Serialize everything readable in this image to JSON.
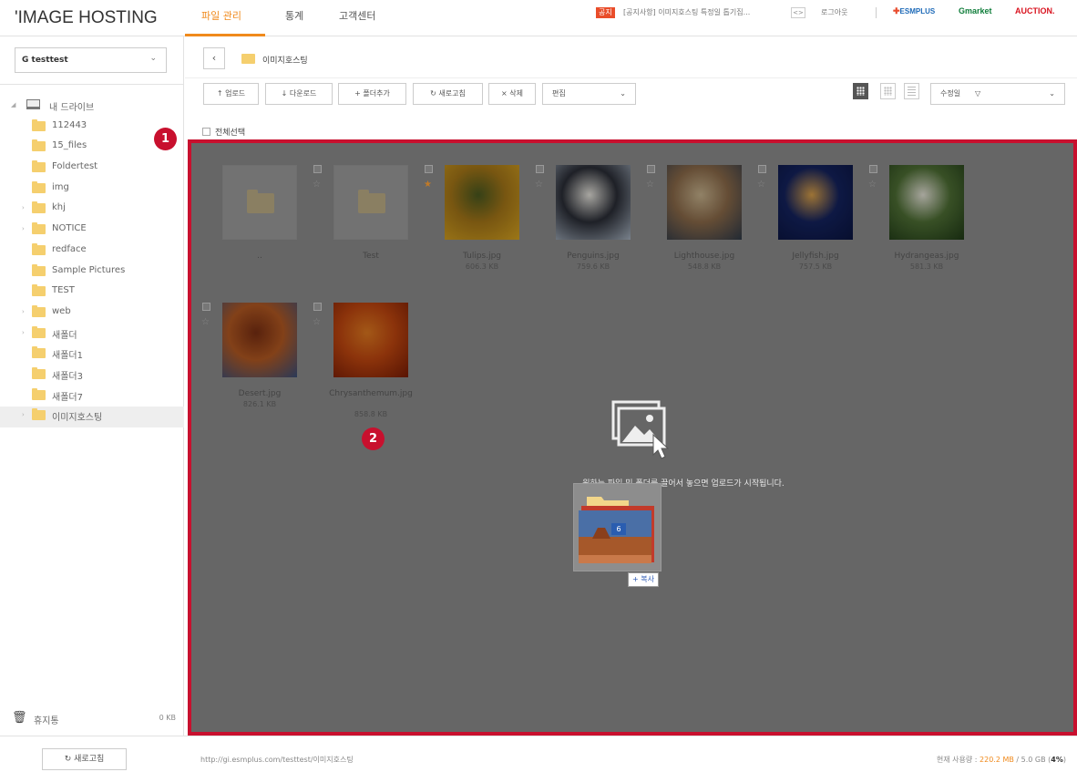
{
  "header": {
    "brand": "'IMAGE HOSTING",
    "tabs": [
      {
        "label": "파일 관리",
        "active": true
      },
      {
        "label": "통계",
        "active": false
      },
      {
        "label": "고객센터",
        "active": false
      }
    ],
    "notice_badge": "공지",
    "notice_text": "[공지사항] 이미지호스팅 특정일 톱기집...",
    "notice_more": "<>",
    "logout": "로그아웃",
    "partners": [
      "ESMPLUS",
      "Gmarket",
      "AUCTION."
    ],
    "accent_color": "#f08a1c"
  },
  "sidebar": {
    "account": "G testtest",
    "drive_label": "내 드라이브",
    "folders": [
      {
        "label": "112443",
        "expandable": false,
        "selected": false
      },
      {
        "label": "15_files",
        "expandable": false,
        "selected": false
      },
      {
        "label": "Foldertest",
        "expandable": false,
        "selected": false
      },
      {
        "label": "img",
        "expandable": false,
        "selected": false
      },
      {
        "label": "khj",
        "expandable": true,
        "selected": false
      },
      {
        "label": "NOTICE",
        "expandable": true,
        "selected": false
      },
      {
        "label": "redface",
        "expandable": false,
        "selected": false
      },
      {
        "label": "Sample Pictures",
        "expandable": false,
        "selected": false
      },
      {
        "label": "TEST",
        "expandable": false,
        "selected": false
      },
      {
        "label": "web",
        "expandable": true,
        "selected": false
      },
      {
        "label": "새폴더",
        "expandable": true,
        "selected": false
      },
      {
        "label": "새폴더1",
        "expandable": false,
        "selected": false
      },
      {
        "label": "새폴더3",
        "expandable": false,
        "selected": false
      },
      {
        "label": "새폴더7",
        "expandable": false,
        "selected": false
      },
      {
        "label": "이미지호스팅",
        "expandable": true,
        "selected": true
      }
    ],
    "trash_label": "휴지통",
    "trash_size": "0 KB",
    "refresh_label": "새로고침"
  },
  "main": {
    "path_label": "이미지호스팅",
    "toolbar": {
      "upload": "업로드",
      "download": "다운로드",
      "add_folder": "폴더추가",
      "refresh": "새로고침",
      "delete": "삭제",
      "edit_select": "편집",
      "sort_select": "수정일"
    },
    "select_all": "전체선택",
    "items": [
      {
        "type": "parent",
        "name": "..",
        "size": "",
        "starred": false,
        "checkbox": false
      },
      {
        "type": "folder",
        "name": "Test",
        "size": "",
        "starred": false,
        "checkbox": true
      },
      {
        "type": "image",
        "name": "Tulips.jpg",
        "size": "606.3 KB",
        "starred": true,
        "checkbox": true,
        "palette": [
          "#d9a520",
          "#a77818",
          "#4b5a1f"
        ]
      },
      {
        "type": "image",
        "name": "Penguins.jpg",
        "size": "759.6 KB",
        "starred": false,
        "checkbox": true,
        "palette": [
          "#a8b4c2",
          "#2a2d36",
          "#e8e6df"
        ]
      },
      {
        "type": "image",
        "name": "Lighthouse.jpg",
        "size": "548.8 KB",
        "starred": false,
        "checkbox": true,
        "palette": [
          "#2f3a48",
          "#8c6b4a",
          "#c9b48e"
        ]
      },
      {
        "type": "image",
        "name": "Jellyfish.jpg",
        "size": "757.5 KB",
        "starred": false,
        "checkbox": true,
        "palette": [
          "#0a1440",
          "#13225e",
          "#d9a04a"
        ]
      },
      {
        "type": "image",
        "name": "Hydrangeas.jpg",
        "size": "581.3 KB",
        "starred": false,
        "checkbox": true,
        "palette": [
          "#1f3a16",
          "#4e6f34",
          "#e6e4d8"
        ]
      },
      {
        "type": "image",
        "name": "Desert.jpg",
        "size": "826.1 KB",
        "starred": false,
        "checkbox": true,
        "palette": [
          "#3a4f7a",
          "#b55a22",
          "#7b2f12"
        ]
      },
      {
        "type": "image",
        "name": "Chrysanthemum.jpg",
        "size": "858.8 KB",
        "starred": false,
        "checkbox": true,
        "palette": [
          "#7a1c05",
          "#c2470f",
          "#e27a20"
        ]
      }
    ],
    "drop_hint": "원하는 파일 및 폴더를 끌어서 놓으면 업로드가 시작됩니다.",
    "drag_count": "6",
    "drag_copy_label": "+ 복사",
    "markers": [
      "1",
      "2"
    ],
    "overlay_color": "#666666",
    "highlight_color": "#c8102e"
  },
  "footer": {
    "url": "http://gi.esmplus.com/testtest/이미지호스팅",
    "usage_prefix": "현재 사용량 : ",
    "usage_used": "220.2 MB",
    "usage_total": " / 5.0 GB (",
    "usage_pct": "4%",
    "usage_suffix": ")"
  }
}
